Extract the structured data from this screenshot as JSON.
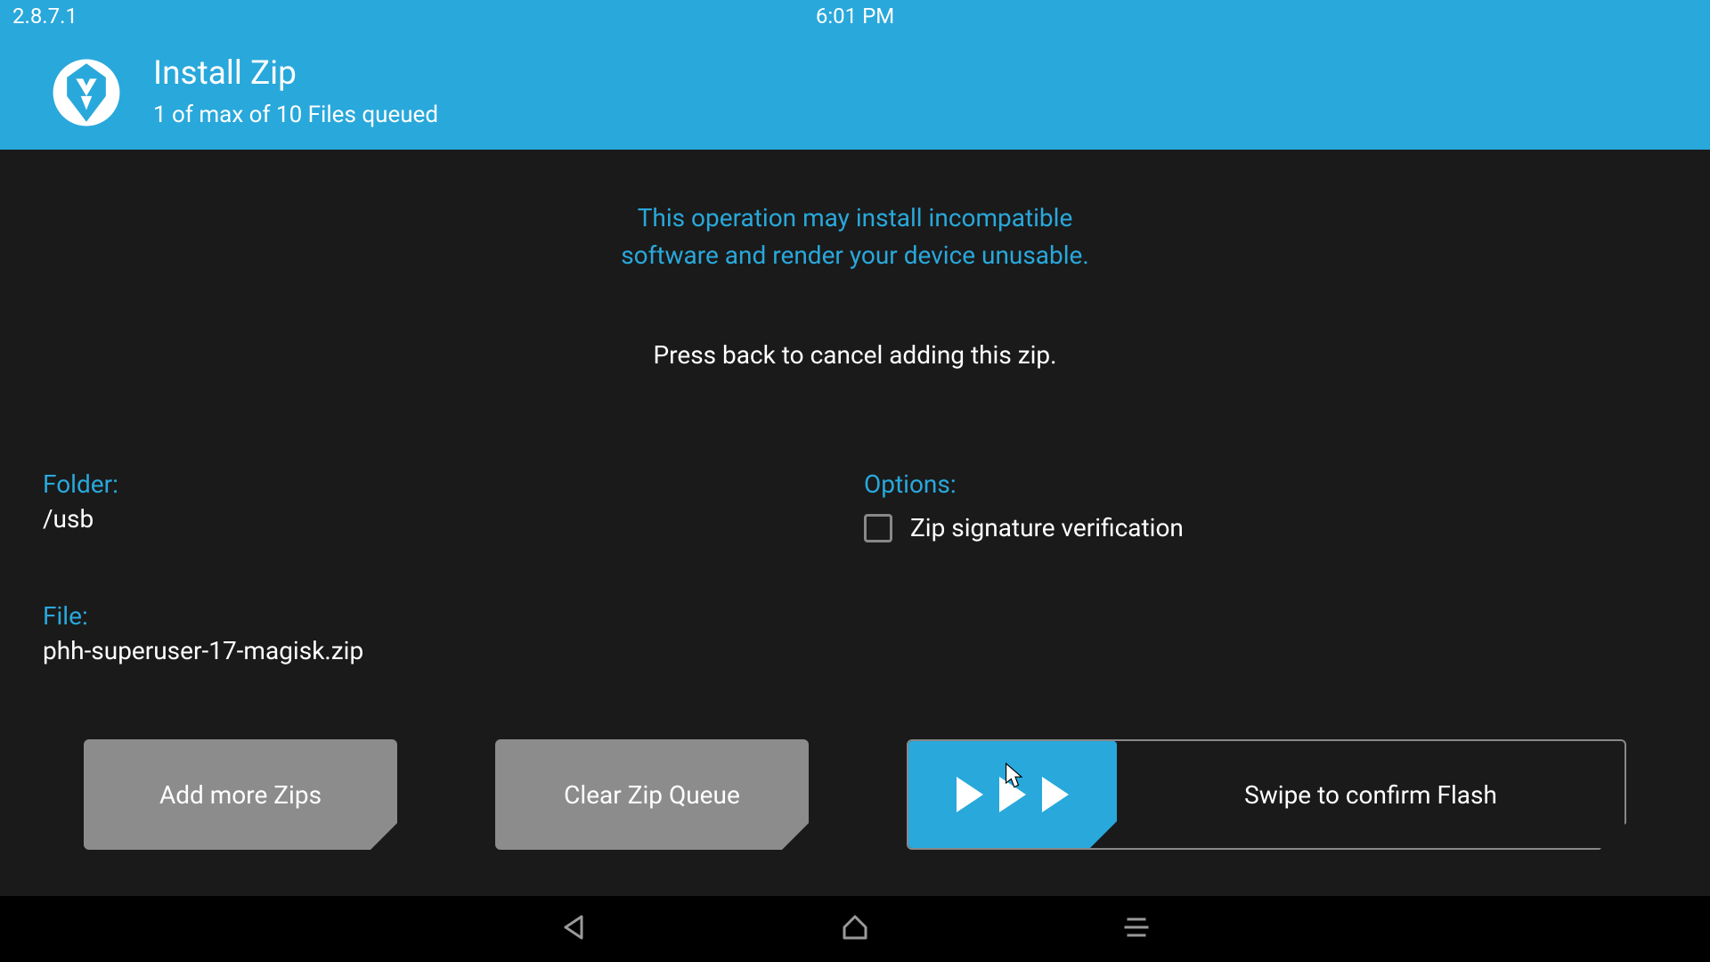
{
  "status": {
    "version": "2.8.7.1",
    "time": "6:01 PM"
  },
  "header": {
    "title": "Install Zip",
    "subtitle": "1 of max of 10 Files queued"
  },
  "warning": {
    "line1": "This operation may install incompatible",
    "line2": "software and render your device unusable."
  },
  "instruction": "Press back to cancel adding this zip.",
  "folder": {
    "label": "Folder:",
    "value": "/usb"
  },
  "file": {
    "label": "File:",
    "value": "phh-superuser-17-magisk.zip"
  },
  "options": {
    "label": "Options:",
    "zip_verify": "Zip signature verification"
  },
  "buttons": {
    "add_more": "Add more Zips",
    "clear_queue": "Clear Zip Queue",
    "swipe": "Swipe to confirm Flash"
  }
}
